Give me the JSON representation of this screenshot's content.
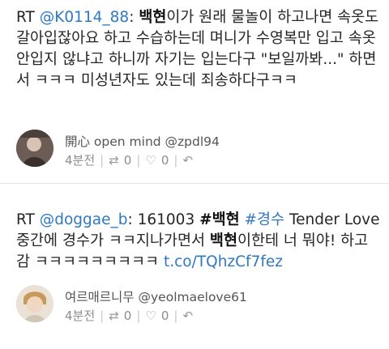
{
  "tweets": [
    {
      "rt": "RT",
      "mention": "@K0114_88",
      "colon": ":",
      "name_bold": "백현",
      "text_rest": "이가 원래 물놀이 하고나면 속옷도 갈아입잖아요 하고 수습하는데 며니가 수영복만 입고 속옷 안입지 않냐고 하니까 자기는 입는다구 \"보일까봐...\" 하면서 ㅋㅋㅋ 미성년자도 있는데 죄송하다구ㅋㅋ",
      "display_name": "開心 open mind",
      "handle": "@zpdl94",
      "time": "4분전",
      "retweets": "0",
      "likes": "0",
      "avatar_color": "#7b6a63"
    },
    {
      "rt": "RT",
      "mention": "@doggae_b",
      "colon": ":",
      "text_prefix": "161003",
      "tag1": "#백현",
      "tag2": "#경수",
      "text_mid": "Tender Love 중간에 경수가 ㅋㅋ지나가면서",
      "name_bold": "백현",
      "text_rest": "이한테 너 뭐야! 하고감 ㅋㅋㅋㅋㅋㅋㅋㅋㅋ",
      "link": "t.co/TQhzCf7fez",
      "display_name": "여르매르니무",
      "handle": "@yeolmaelove61",
      "time": "4분전",
      "retweets": "0",
      "likes": "0",
      "avatar_color": "#d8cdbd"
    }
  ],
  "icons": {
    "retweet": "retweet-icon",
    "like": "heart-icon",
    "reply": "reply-icon"
  },
  "colors": {
    "link": "#2f78c4",
    "meta": "#8d8d8d"
  }
}
